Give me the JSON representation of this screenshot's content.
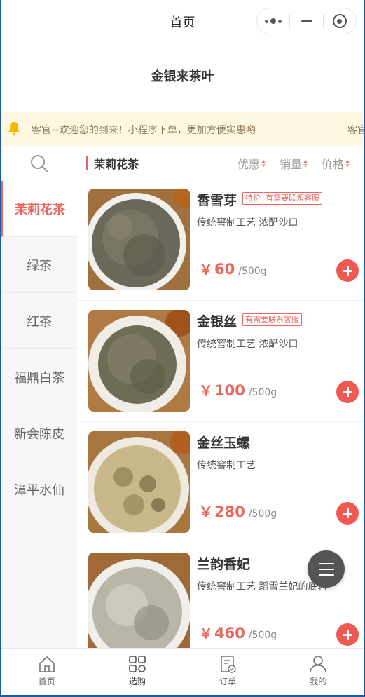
{
  "navbar": {
    "title": "首页"
  },
  "shop": {
    "name": "金银来茶叶"
  },
  "notice": {
    "text": "客官~欢迎您的到来！小程序下单，更加方便实惠哟",
    "text_repeat": "客官"
  },
  "sidebar": {
    "search_icon": "search-icon",
    "categories": [
      {
        "label": "茉莉花茶",
        "active": true
      },
      {
        "label": "绿茶"
      },
      {
        "label": "红茶"
      },
      {
        "label": "福鼎白茶"
      },
      {
        "label": "新会陈皮"
      },
      {
        "label": "漳平水仙"
      }
    ]
  },
  "section": {
    "title": "茉莉花茶",
    "sorts": [
      {
        "label": "优惠"
      },
      {
        "label": "销量"
      },
      {
        "label": "价格"
      }
    ]
  },
  "products": [
    {
      "name": "香雪芽",
      "tags": [
        "特价",
        "有需要联系客服"
      ],
      "desc": "传统窨制工艺 浓酽沙口",
      "currency": "￥",
      "price": "60",
      "unit": "/500g"
    },
    {
      "name": "金银丝",
      "tags": [
        "有需要联系客服"
      ],
      "desc": "传统窨制工艺 浓酽沙口",
      "currency": "￥",
      "price": "100",
      "unit": "/500g"
    },
    {
      "name": "金丝玉螺",
      "tags": [],
      "desc": "传统窨制工艺",
      "currency": "￥",
      "price": "280",
      "unit": "/500g"
    },
    {
      "name": "兰韵香妃",
      "tags": [],
      "desc": "传统窨制工艺 蹈雪兰妃的底料",
      "currency": "￥",
      "price": "460",
      "unit": "/500g"
    }
  ],
  "tabbar": [
    {
      "label": "首页",
      "icon": "home-icon"
    },
    {
      "label": "选购",
      "icon": "grid-icon",
      "active": true
    },
    {
      "label": "订单",
      "icon": "order-icon"
    },
    {
      "label": "我的",
      "icon": "user-icon"
    }
  ],
  "colors": {
    "accent": "#e8665c",
    "add_button": "#ee5a52",
    "notice_bg": "#fff8e1"
  }
}
